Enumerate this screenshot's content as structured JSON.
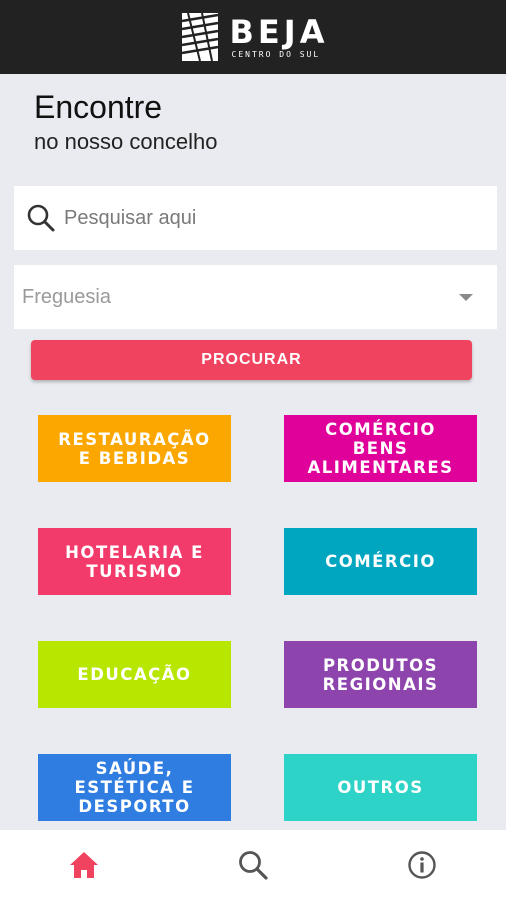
{
  "brand": {
    "title": "BEJA",
    "subtitle": "CENTRO DO SUL"
  },
  "heading": {
    "title": "Encontre",
    "subtitle": "no nosso concelho"
  },
  "search": {
    "placeholder": "Pesquisar aqui",
    "value": ""
  },
  "parish_select": {
    "placeholder": "Freguesia"
  },
  "submit_label": "PROCURAR",
  "categories": [
    {
      "label": "RESTAURAÇÃO\nE BEBIDAS",
      "color": "#fba700"
    },
    {
      "label": "COMÉRCIO\nBENS\nALIMENTARES",
      "color": "#e0009a"
    },
    {
      "label": "HOTELARIA E\nTURISMO",
      "color": "#f23b6b"
    },
    {
      "label": "COMÉRCIO",
      "color": "#00a5c0"
    },
    {
      "label": "EDUCAÇÃO",
      "color": "#b7e600"
    },
    {
      "label": "PRODUTOS\nREGIONAIS",
      "color": "#8e44ad"
    },
    {
      "label": "SAÚDE,\nESTÉTICA E\nDESPORTO",
      "color": "#2f7de0"
    },
    {
      "label": "OUTROS",
      "color": "#2ed3c7"
    }
  ],
  "colors": {
    "accent": "#f0435f",
    "header_bg": "#222222",
    "page_bg": "#e9ebf0",
    "nav_active": "#f0435f",
    "nav_inactive": "#555555"
  },
  "nav": [
    {
      "icon": "home-icon",
      "active": true
    },
    {
      "icon": "search-icon",
      "active": false
    },
    {
      "icon": "info-icon",
      "active": false
    }
  ]
}
